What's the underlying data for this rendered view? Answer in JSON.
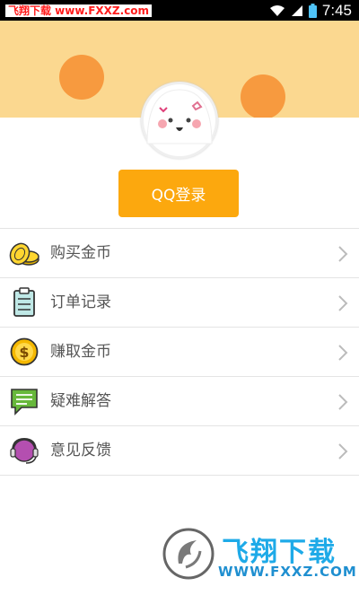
{
  "status_bar": {
    "watermark": "飞翔下载 www.FXXZ.com",
    "time": "7:45"
  },
  "login": {
    "label": "QQ登录"
  },
  "menu": {
    "items": [
      {
        "label": "购买金币",
        "icon": "gold-coins-icon"
      },
      {
        "label": "订单记录",
        "icon": "clipboard-icon"
      },
      {
        "label": "赚取金币",
        "icon": "dollar-coin-icon"
      },
      {
        "label": "疑难解答",
        "icon": "chat-bubble-icon"
      },
      {
        "label": "意见反馈",
        "icon": "headset-icon"
      }
    ]
  },
  "watermark_bottom": {
    "title": "飞翔下载",
    "url": "WWW.FXXZ.COM"
  },
  "colors": {
    "accent": "#fca80e",
    "banner": "#fbd890",
    "blob": "#f79a3f"
  }
}
